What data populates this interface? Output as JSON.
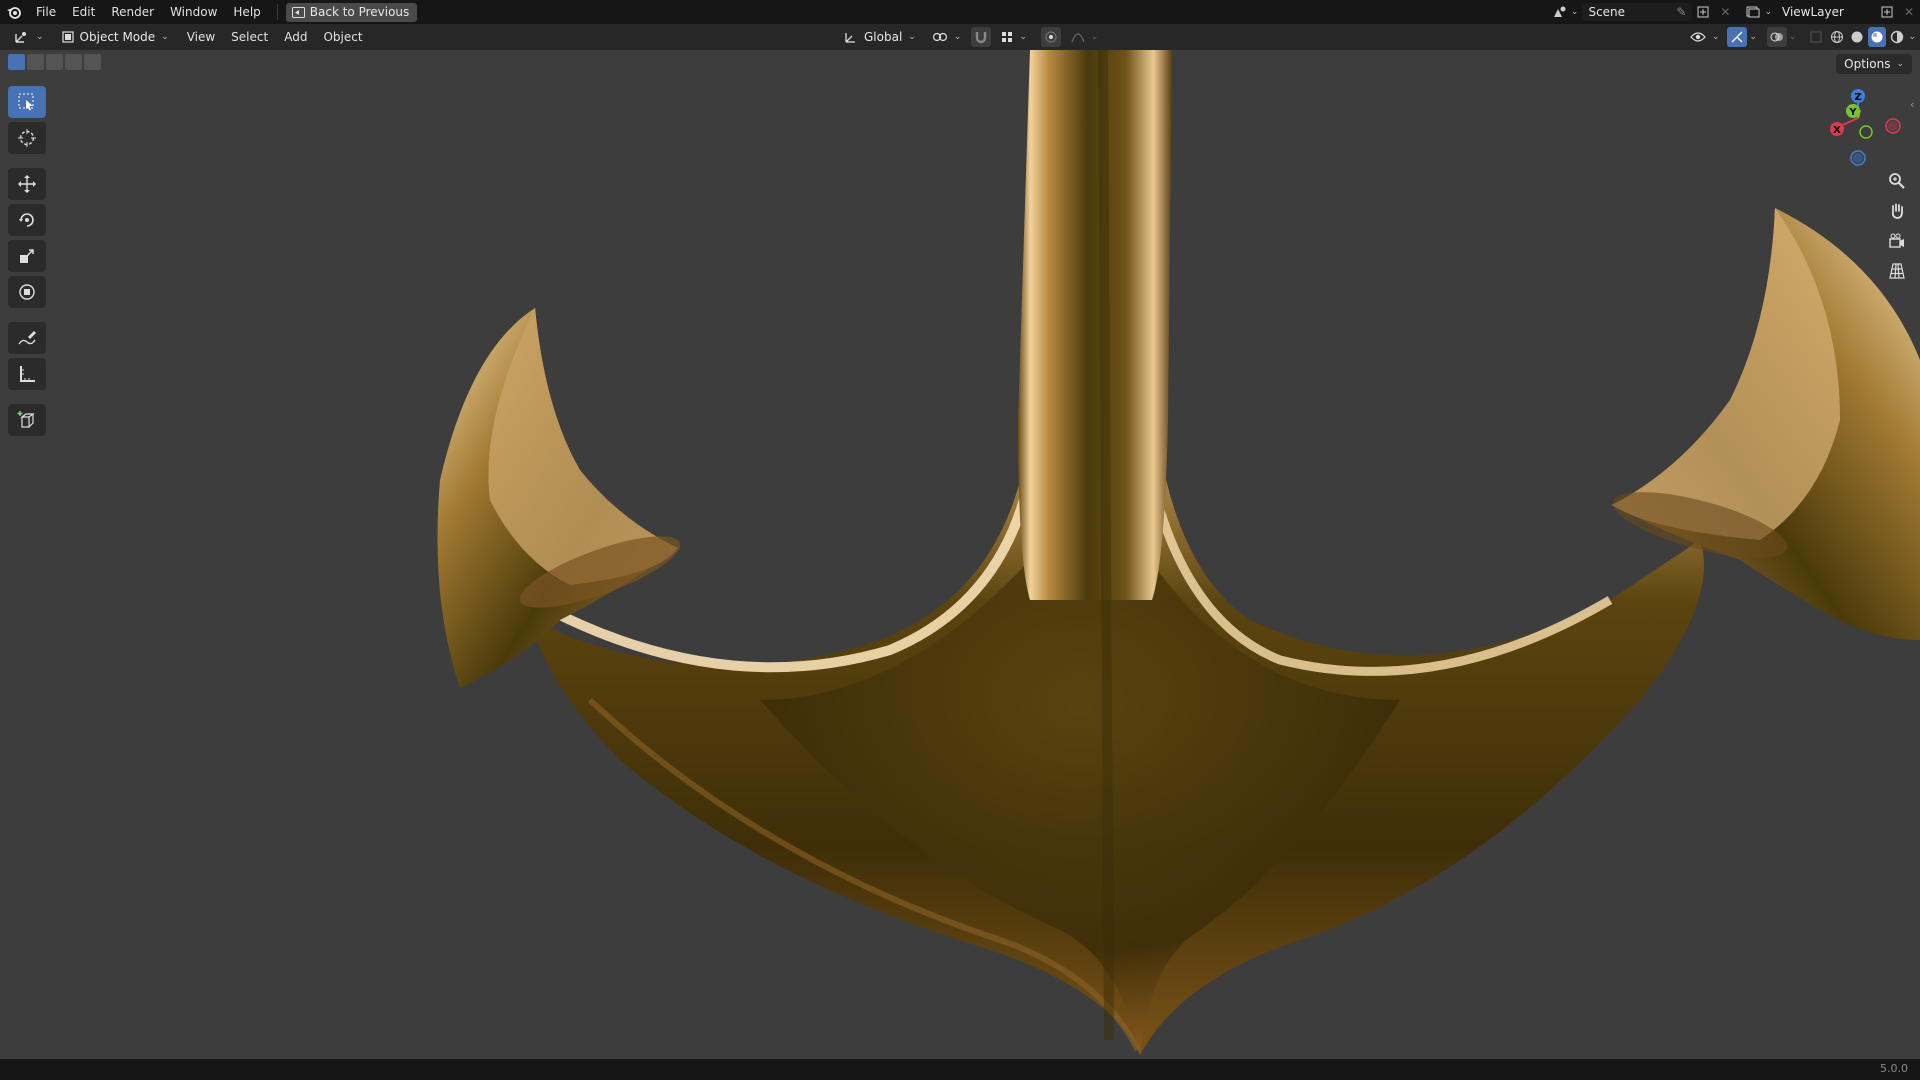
{
  "menu": {
    "items": [
      "File",
      "Edit",
      "Render",
      "Window",
      "Help"
    ],
    "back_label": "Back to Previous"
  },
  "topright": {
    "scene_label": "Scene",
    "view_layer_label": "ViewLayer"
  },
  "header": {
    "mode_label": "Object Mode",
    "menus": [
      "View",
      "Select",
      "Add",
      "Object"
    ],
    "transform_orientation": "Global"
  },
  "viewport": {
    "options_label": "Options",
    "gizmo_axes": {
      "z": "Z",
      "y": "Y",
      "x": "X"
    },
    "axis_colors": {
      "x": "#e0394f",
      "y": "#7ac42b",
      "z": "#3d80d8"
    },
    "object": "gold anchor"
  },
  "statusbar": {
    "version": "5.0.0"
  },
  "colors": {
    "accent": "#4772b3",
    "bg_viewport": "#3d3d3d",
    "topbar": "#161616",
    "header": "#272727"
  }
}
